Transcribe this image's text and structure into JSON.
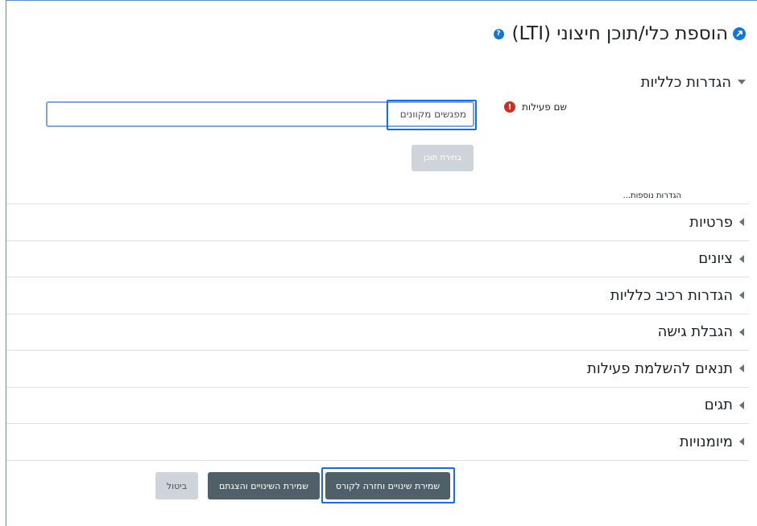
{
  "header": {
    "title": "הוספת כלי/תוכן חיצוני (LTI)",
    "icon": "external-tool-icon",
    "help_icon": "help-icon"
  },
  "general_section": {
    "title": "הגדרות כלליות",
    "field_label": "שם פעילות",
    "field_value": "מפגשים מקוונים",
    "select_content_label": "בחירת תוכן",
    "more_settings_label": "הגדרות נוספות..."
  },
  "collapsed_sections": [
    {
      "title": "פרטיות"
    },
    {
      "title": "ציונים"
    },
    {
      "title": "הגדרות רכיב כלליות"
    },
    {
      "title": "הגבלת גישה"
    },
    {
      "title": "תנאים להשלמת פעילות"
    },
    {
      "title": "תגים"
    },
    {
      "title": "מיומנויות"
    }
  ],
  "footer": {
    "save_return_label": "שמירת שינויים וחזרה לקורס",
    "save_display_label": "שמירת השינויים והצגתם",
    "cancel_label": "ביטול"
  },
  "colors": {
    "accent": "#0f6cff",
    "primary_button": "#4f6069",
    "required": "#ca3120",
    "icon_blue": "#1177d1"
  }
}
